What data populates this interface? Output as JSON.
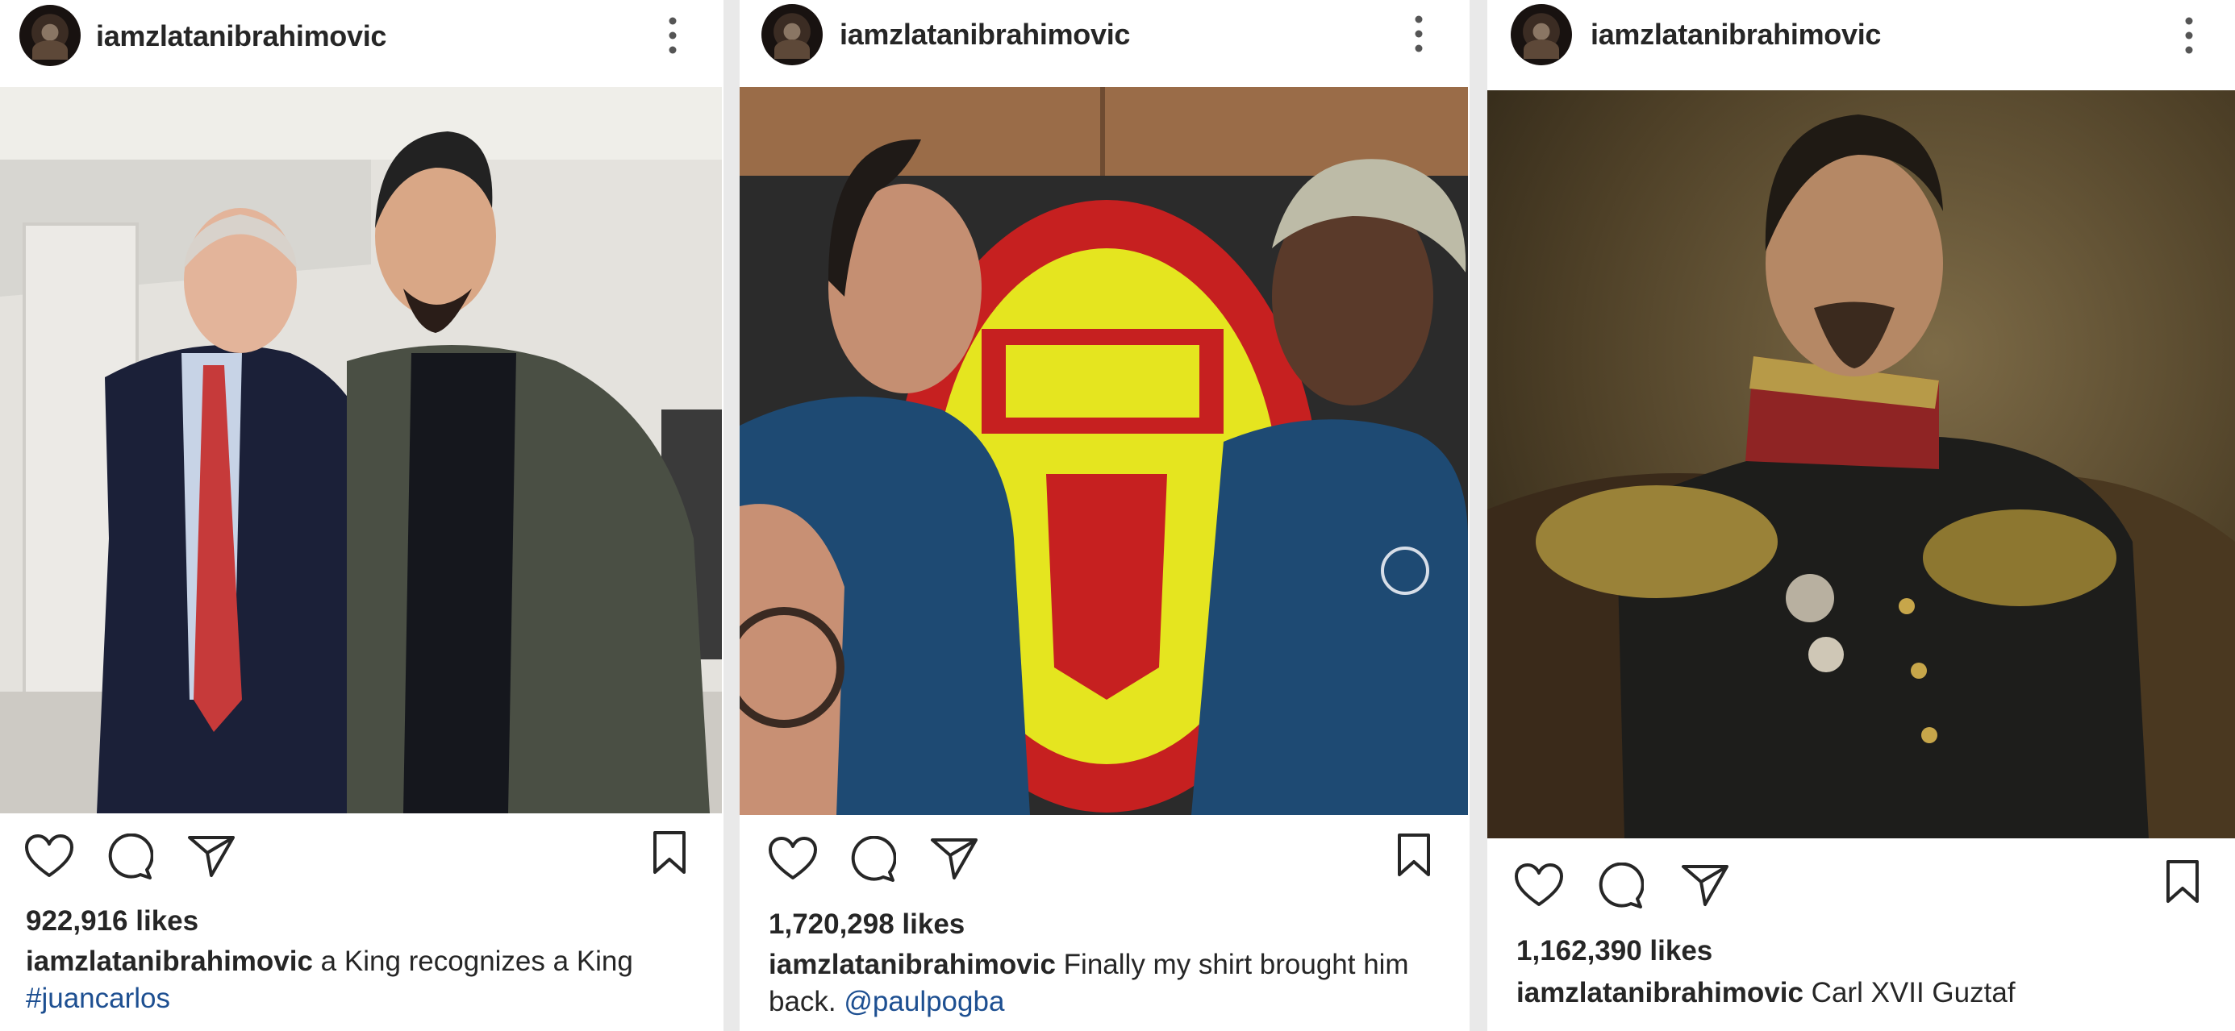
{
  "colors": {
    "text": "#262626",
    "link": "#1d4f91",
    "icon": "#262626",
    "background": "#ffffff"
  },
  "posts": [
    {
      "username": "iamzlatanibrahimovic",
      "icons": {
        "avatar": "profile-avatar",
        "more": "more-options-icon",
        "like": "heart-icon",
        "comment": "comment-icon",
        "share": "send-icon",
        "save": "bookmark-icon"
      },
      "likes": "922,916 likes",
      "caption_user": "iamzlatanibrahimovic",
      "caption_text": " a King recognizes a King",
      "caption_link": "#juancarlos"
    },
    {
      "username": "iamzlatanibrahimovic",
      "icons": {
        "avatar": "profile-avatar",
        "more": "more-options-icon",
        "like": "heart-icon",
        "comment": "comment-icon",
        "share": "send-icon",
        "save": "bookmark-icon"
      },
      "likes": "1,720,298 likes",
      "caption_user": "iamzlatanibrahimovic",
      "caption_text": " Finally my shirt brought him back. ",
      "caption_link": "@paulpogba"
    },
    {
      "username": "iamzlatanibrahimovic",
      "icons": {
        "avatar": "profile-avatar",
        "more": "more-options-icon",
        "like": "heart-icon",
        "comment": "comment-icon",
        "share": "send-icon",
        "save": "bookmark-icon"
      },
      "likes": "1,162,390 likes",
      "caption_user": "iamzlatanibrahimovic",
      "caption_text": " Carl XVII Guztaf",
      "caption_link": ""
    }
  ]
}
